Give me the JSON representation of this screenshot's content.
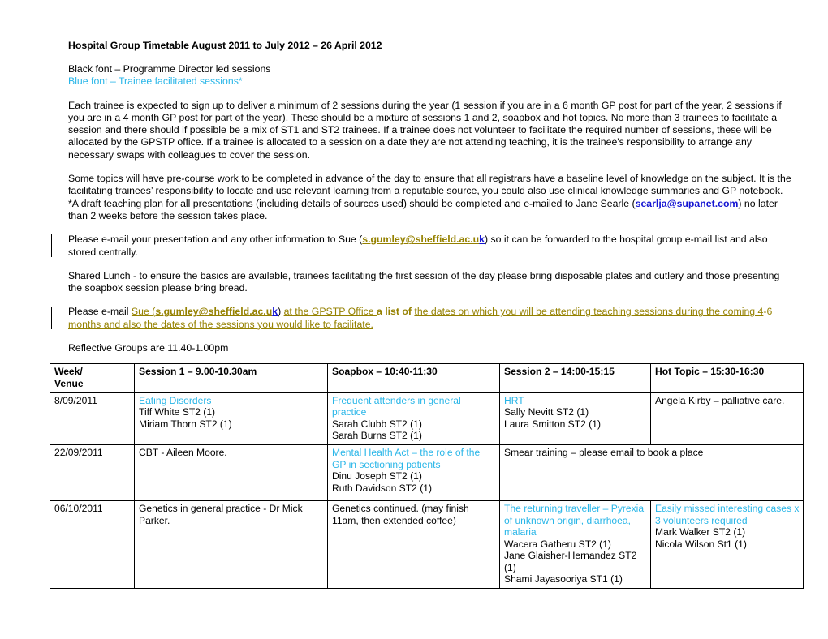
{
  "document": {
    "title": "Hospital Group Timetable August 2011 to July 2012 – 26 April 2012",
    "legend": {
      "black_line": "Black font – Programme Director led sessions",
      "blue_line": "Blue font – Trainee facilitated sessions*"
    },
    "paragraphs": {
      "expectations": "Each trainee is expected to sign up to deliver a minimum of 2 sessions during the year (1 session if you are in a 6 month GP post for part of the year, 2 sessions if you are in a 4 month GP post for part of the year).  These should be a mixture of sessions 1 and 2, soapbox and hot topics. No more than 3 trainees to facilitate a session and there should if possible be a mix of ST1 and ST2 trainees.  If a trainee does not volunteer to facilitate the required number of sessions, these will be allocated by the GPSTP office.  If a trainee is allocated to a session on a date they are not attending teaching, it is the trainee's responsibility to arrange any necessary swaps with colleagues to cover the session.",
      "precourse_part1": "Some topics will have pre-course work to be completed in advance of the day to ensure that all registrars have a baseline level of knowledge on the subject. It is the facilitating trainees’ responsibility to locate and use relevant learning from a reputable source, you could also use clinical knowledge summaries and GP notebook.  *A draft teaching plan for all presentations (including details of sources used) should be completed and e-mailed to Jane Searle (",
      "precourse_email": "searlja@supanet.com",
      "precourse_part2": ") no later than 2 weeks before the session takes place.",
      "presentation_part1": "Please e-mail your presentation and any other information to Sue (",
      "presentation_email_main": "s.gumley@sheffield.ac.u",
      "presentation_email_tail": "k",
      "presentation_part2": ") so it can be forwarded to the hospital group e-mail list and also stored centrally.",
      "shared_lunch": "Shared Lunch - to ensure the basics are available, trainees facilitating the first session of the day please bring disposable plates and cutlery and those presenting the soapbox session please bring bread.",
      "dates_request": {
        "lead": "Please e-mail ",
        "sue_label": "Sue (",
        "email_main": "s.gumley@sheffield.ac.u",
        "email_tail": "k",
        "after_email": ") ",
        "office": "at the GPSTP Office ",
        "mid": "a list of ",
        "tail": "the dates on which you will be attending teaching sessions during the coming 4",
        "dash": "-6",
        "tail2": " months and also the dates of the sessions you would like to facilitate."
      },
      "reflective_groups": "Reflective Groups are 11.40-1.00pm"
    }
  },
  "colors": {
    "trainee_blue": "#29b6e8",
    "email_blue": "#1414d2",
    "olive_link": "#958100",
    "border": "#000000"
  },
  "timetable": {
    "headers": [
      "Week/ Venue",
      "Session 1 – 9.00-10.30am",
      "Soapbox – 10:40-11:30",
      "Session 2 – 14:00-15:15",
      "Hot Topic – 15:30-16:30"
    ],
    "header_week_line1": "Week/",
    "header_week_line2": "Venue",
    "rows": [
      {
        "date": "8/09/2011",
        "session1": {
          "topic": "Eating Disorders",
          "people": [
            "Tiff White ST2 (1)",
            "Miriam Thorn ST2 (1)"
          ]
        },
        "soapbox": {
          "topic": "Frequent attenders in general practice",
          "people": [
            "Sarah Clubb ST2 (1)",
            "Sarah Burns ST2 (1)"
          ]
        },
        "session2": {
          "topic": "HRT",
          "people": [
            "Sally Nevitt ST2 (1)",
            "Laura Smitton ST2 (1)"
          ]
        },
        "hottopic": {
          "topic": "",
          "people": [
            "Angela Kirby – palliative care."
          ]
        }
      },
      {
        "date": "22/09/2011",
        "session1": {
          "topic": "",
          "people": [
            "CBT - Aileen Moore."
          ]
        },
        "soapbox": {
          "topic": "Mental Health Act – the role of the GP in sectioning patients",
          "people": [
            "Dinu Joseph ST2 (1)",
            "Ruth Davidson ST2 (1)"
          ]
        },
        "merged_tail": "Smear training – please email to book a place"
      },
      {
        "date": "06/10/2011",
        "session1": {
          "topic": "",
          "people": [
            "Genetics in general practice - Dr Mick Parker."
          ]
        },
        "soapbox": {
          "topic": "",
          "people": [
            "Genetics continued.  (may finish 11am, then extended coffee)"
          ]
        },
        "session2": {
          "topic": "The returning traveller – Pyrexia of unknown origin, diarrhoea, malaria",
          "people": [
            "Wacera Gatheru ST2 (1)",
            "Jane Glaisher-Hernandez ST2 (1)",
            "Shami Jayasooriya ST1 (1)"
          ]
        },
        "hottopic": {
          "topic": "Easily missed interesting cases x 3 volunteers required",
          "people": [
            "Mark Walker ST2 (1)",
            "Nicola Wilson St1 (1)"
          ]
        }
      }
    ]
  }
}
